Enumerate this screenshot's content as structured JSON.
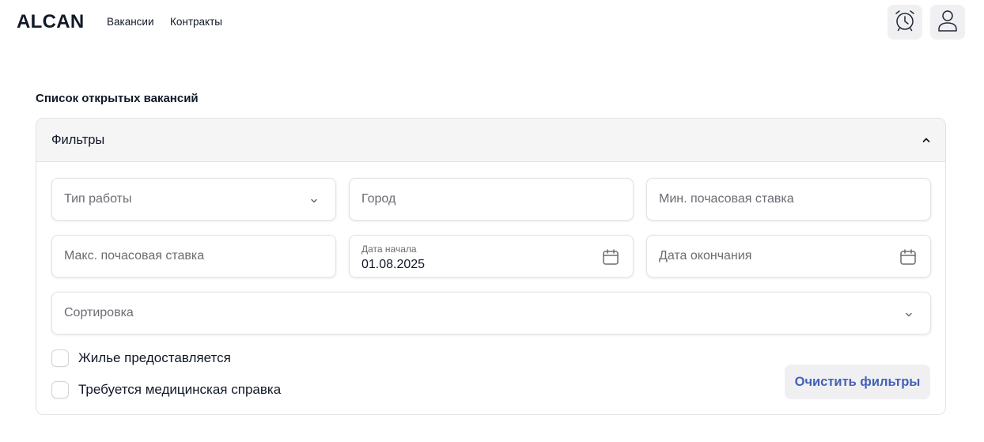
{
  "header": {
    "logo": "ALCAN",
    "nav": [
      {
        "label": "Вакансии"
      },
      {
        "label": "Контракты"
      }
    ],
    "icons": [
      "alarm-clock-icon",
      "user-icon"
    ]
  },
  "page": {
    "title": "Список открытых вакансий"
  },
  "filters": {
    "title": "Фильтры",
    "expanded": true,
    "job_type": {
      "placeholder": "Тип работы"
    },
    "city": {
      "placeholder": "Город"
    },
    "min_rate": {
      "placeholder": "Мин. почасовая ставка"
    },
    "max_rate": {
      "placeholder": "Макс. почасовая ставка"
    },
    "start_date": {
      "label": "Дата начала",
      "value": "01.08.2025"
    },
    "end_date": {
      "placeholder": "Дата окончания"
    },
    "sort": {
      "placeholder": "Сортировка"
    },
    "checkboxes": [
      {
        "label": "Жилье предоставляется",
        "checked": false
      },
      {
        "label": "Требуется медицинская справка",
        "checked": false
      }
    ],
    "clear_label": "Очистить фильтры"
  },
  "colors": {
    "accent": "#4361b8",
    "header_bg": "#f5f5f6",
    "border": "#e2e2e6"
  }
}
